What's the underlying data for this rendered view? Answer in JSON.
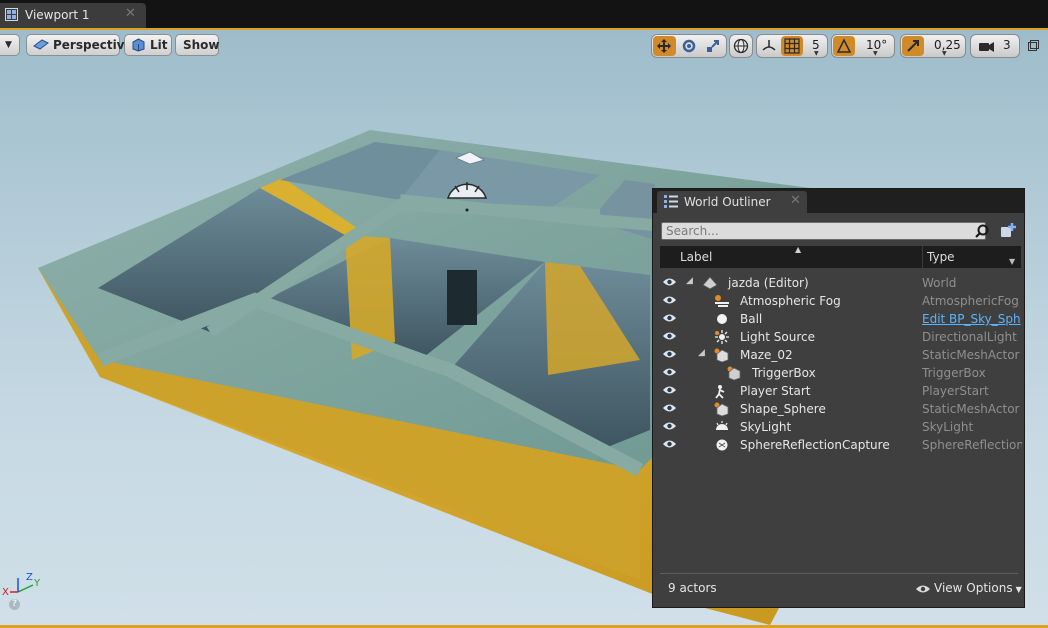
{
  "tab": {
    "title": "Viewport 1",
    "close": "✕",
    "icon": "viewport-grid-icon"
  },
  "toolbar": {
    "perspective_label": "Perspective",
    "lit_label": "Lit",
    "show_label": "Show",
    "grid_snap_value": "5",
    "rotation_snap_value": "10°",
    "scale_snap_value": "0,25",
    "camera_speed_value": "3",
    "snap_active_color": "#d08a2a"
  },
  "outliner": {
    "title": "World Outliner",
    "close": "✕",
    "search_placeholder": "Search...",
    "col_label": "Label",
    "col_type": "Type",
    "rows": [
      {
        "label": "jazda (Editor)",
        "type": "World",
        "icon": "world-icon"
      },
      {
        "label": "Atmospheric Fog",
        "type": "AtmosphericFog",
        "icon": "fog-icon"
      },
      {
        "label": "Ball",
        "type": "Edit BP_Sky_Sph",
        "icon": "sphere-icon"
      },
      {
        "label": "Light Source",
        "type": "DirectionalLight",
        "icon": "sun-icon"
      },
      {
        "label": "Maze_02",
        "type": "StaticMeshActor",
        "icon": "static-mesh-icon"
      },
      {
        "label": "TriggerBox",
        "type": "TriggerBox",
        "icon": "trigger-box-icon"
      },
      {
        "label": "Player Start",
        "type": "PlayerStart",
        "icon": "player-start-icon"
      },
      {
        "label": "Shape_Sphere",
        "type": "StaticMeshActor",
        "icon": "static-mesh-icon"
      },
      {
        "label": "SkyLight",
        "type": "SkyLight",
        "icon": "skylight-icon"
      },
      {
        "label": "SphereReflectionCapture",
        "type": "SphereReflectionC",
        "icon": "reflection-capture-icon"
      }
    ],
    "actor_count": "9 actors",
    "view_options": "View Options"
  },
  "gizmo": {
    "x": "X",
    "y": "Y",
    "z": "Z",
    "help": "?"
  }
}
